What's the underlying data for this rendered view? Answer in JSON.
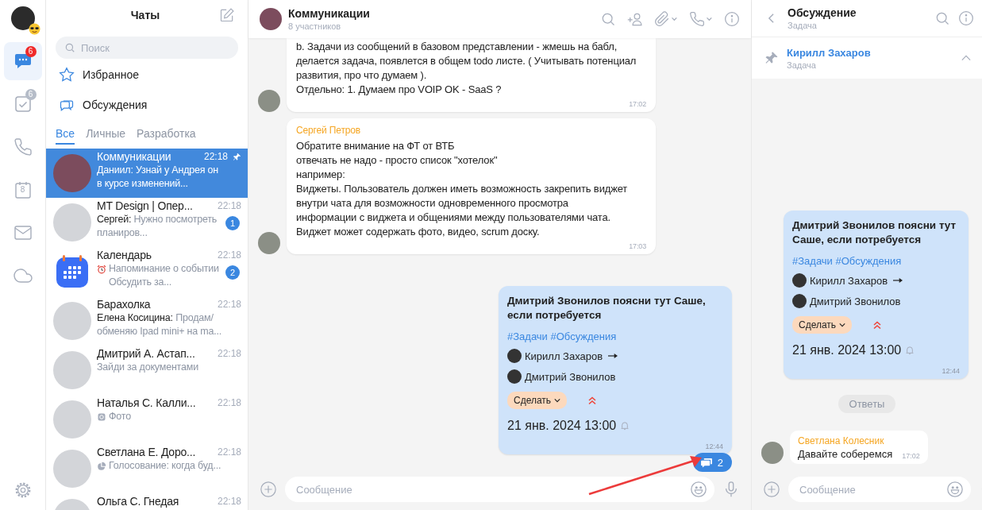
{
  "rail": {
    "items": [
      {
        "kind": "chats",
        "selected": true,
        "badge": "6",
        "badge_muted": false
      },
      {
        "kind": "tasks",
        "selected": false,
        "badge": "6",
        "badge_muted": true
      },
      {
        "kind": "calls",
        "selected": false
      },
      {
        "kind": "calendar",
        "selected": false,
        "label": "8"
      },
      {
        "kind": "mail",
        "selected": false
      },
      {
        "kind": "cloud",
        "selected": false
      }
    ]
  },
  "chat_list": {
    "title": "Чаты",
    "search": {
      "placeholder": "Поиск"
    },
    "folders": [
      {
        "kind": "favorites",
        "label": "Избранное"
      },
      {
        "kind": "discussions",
        "label": "Обсуждения"
      }
    ],
    "tabs": [
      {
        "label": "Все",
        "selected": true
      },
      {
        "label": "Личные",
        "selected": false
      },
      {
        "label": "Разработка",
        "selected": false
      }
    ],
    "chats": [
      {
        "kind": "contact",
        "name": "Коммуникации",
        "time": "22:18",
        "preview": {
          "kind": "message",
          "sender": "Даниил:",
          "text": "Узнай у Андрея он в курсе изменений..."
        },
        "pinned": true,
        "selected": true
      },
      {
        "kind": "contact",
        "name": "MT Design | Опер...",
        "time": "22:18",
        "preview": {
          "kind": "message",
          "sender": "Сергей:",
          "text": "Нужно посмотреть планиров..."
        },
        "unread": "1",
        "pinned": false,
        "selected": false
      },
      {
        "kind": "app",
        "name": "Календарь",
        "time": "22:18",
        "preview": {
          "kind": "alarm",
          "text": "Напоминание о событии Обсудить за..."
        },
        "unread": "2",
        "pinned": false,
        "selected": false
      },
      {
        "kind": "contact",
        "name": "Барахолка",
        "time": "22:18",
        "preview": {
          "kind": "message",
          "sender": "Елена Косицина:",
          "text": "Продам/ обменяю Ipad mini+ на ma..."
        },
        "pinned": false,
        "selected": false
      },
      {
        "kind": "contact",
        "name": "Дмитрий А. Астап...",
        "time": "22:18",
        "preview": {
          "kind": "text",
          "text": "Зайди за документами"
        },
        "pinned": false,
        "selected": false
      },
      {
        "kind": "contact",
        "name": "Наталья С. Калли...",
        "time": "22:18",
        "preview": {
          "kind": "photo",
          "text": "Фото"
        },
        "pinned": false,
        "selected": false
      },
      {
        "kind": "contact",
        "name": "Светлана Е. Доро...",
        "time": "22:18",
        "preview": {
          "kind": "poll",
          "text": "Голосование: когда буд..."
        },
        "pinned": false,
        "selected": false
      },
      {
        "kind": "contact",
        "name": "Ольга С. Гнедая",
        "time": "22:18",
        "pinned": false,
        "selected": false
      }
    ]
  },
  "main": {
    "header": {
      "title": "Коммуникации",
      "subtitle": "8 участников"
    },
    "messages": [
      {
        "kind": "text",
        "text": "b. Задачи из сообщений в базовом представлении - жмешь на бабл,\nделается задача, появлется в общем todo листе. ( Учитывать потенциал\nразвития, про что думаем ).\nОтдельно: 1. Думаем про VOIP OK - SaaS ?",
        "time": "17:02"
      },
      {
        "kind": "text",
        "sender": "Сергей Петров",
        "text": "Обратите внимание на ФТ от ВТБ\nотвечать не надо - просто список \"хотелок\"\nнапример:\nВиджеты. Пользователь должен иметь возможность закрепить виджет\nвнутри чата для возможности одновременного просмотра\nинформации с виджета и общениями между пользователями чата.\nВиджет может содержать фото, видео, scrum доску.",
        "time": "17:03"
      },
      {
        "kind": "task",
        "time": "12:44",
        "replies": "2",
        "task": {
          "title": "Дмитрий Звонилов поясни тут Саше, если потребуется",
          "tags": "#Задачи #Обсуждения",
          "assignees": [
            {
              "name": "Кирилл Захаров",
              "arrow": true
            },
            {
              "name": "Дмитрий Звонилов"
            }
          ],
          "status": "Сделать",
          "date": "21 янв. 2024 13:00"
        }
      }
    ],
    "composer": {
      "placeholder": "Сообщение"
    }
  },
  "discussion": {
    "header": {
      "title": "Обсуждение",
      "subtitle": "Задача"
    },
    "pinned": {
      "name": "Кирилл Захаров",
      "subtitle": "Задача",
      "expanded": true
    },
    "time": "12:44",
    "task": {
      "title": "Дмитрий Звонилов поясни тут Саше, если потребуется",
      "tags": "#Задачи #Обсуждения",
      "assignees": [
        {
          "name": "Кирилл Захаров",
          "arrow": true
        },
        {
          "name": "Дмитрий Звонилов"
        }
      ],
      "status": "Сделать",
      "date": "21 янв. 2024 13:00"
    },
    "divider": "Ответы",
    "replies": [
      {
        "sender": "Светлана Колесник",
        "text": "Давайте соберемся",
        "time": "17:02"
      }
    ],
    "composer": {
      "placeholder": "Сообщение"
    }
  }
}
